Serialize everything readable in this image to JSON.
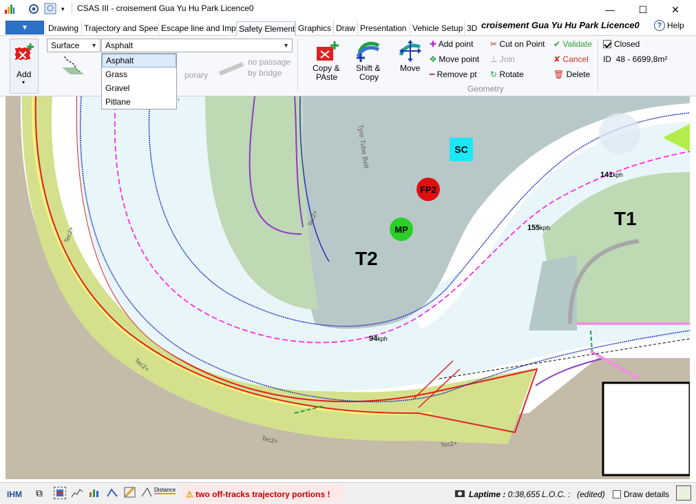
{
  "titlebar": {
    "title": "CSAS III - croisement Gua Yu Hu Park Licence0",
    "minimize": "—",
    "maximize": "☐",
    "close": "✕"
  },
  "tabs": [
    {
      "label": "Drawing"
    },
    {
      "label": "Trajectory and Spee"
    },
    {
      "label": "Escape line and Imp"
    },
    {
      "label": "Safety Element"
    },
    {
      "label": "Graphics"
    },
    {
      "label": "Draw"
    },
    {
      "label": "Presentation"
    },
    {
      "label": "Vehicle Setup"
    },
    {
      "label": "3D"
    }
  ],
  "document_title": "croisement Gua Yu Hu Park Licence0",
  "help_label": "Help",
  "ribbon": {
    "add_label": "Add",
    "surface_combo": "Surface",
    "material_combo": "Asphalt",
    "material_options": [
      "Asphalt",
      "Grass",
      "Gravel",
      "Pitlane"
    ],
    "no_passage": "no passage",
    "by_bridge": "by bridge",
    "faded_label": "porary",
    "copy_paste": [
      "Copy &",
      "PAste"
    ],
    "shift_copy": [
      "Shift &",
      "Copy"
    ],
    "move": "Move",
    "add_point": "Add point",
    "move_point": "Move point",
    "remove_pt": "Remove pt",
    "cut_on_point": "Cut on Point",
    "join": "Join",
    "rotate": "Rotate",
    "validate": "Validate",
    "cancel": "Cancel",
    "delete": "Delete",
    "geometry_group": "Geometry",
    "closed_label": "Closed",
    "closed_checked": true,
    "id_prefix": "ID",
    "id_value": "48 - 6699,8m²"
  },
  "map": {
    "labels": {
      "t1": "T1",
      "t2": "T2",
      "sc": "SC",
      "fp2": "FP2",
      "mp": "MP",
      "speed_141": "141",
      "speed_155": "155",
      "speed_94": "94",
      "speed_unit": "kph",
      "tyre_belt": "Tyre Tube Belt",
      "tec2_a": "Tec2+",
      "tec2_b": "Tec2+",
      "tec2_c": "Tec2+",
      "tec2_d": "Tec2+",
      "tec2_e": "Tec2+",
      "tec2_f": "Tec2+"
    },
    "colors": {
      "green_zone": "#d4e08c",
      "gray_zone": "#c4bba8",
      "track": "#e8f6fa",
      "infield": "#b8c8c8",
      "grass": "#bfd9b4",
      "red_line": "#e02020",
      "magenta": "#ff28e8",
      "purple": "#8a3cc6",
      "blue": "#2632b8"
    }
  },
  "status": {
    "ihm": "IHM",
    "distance_icon_text": "Distance",
    "warning": "two off-tracks trajectory portions !",
    "laptime_label": "Laptime :",
    "laptime_value": "0:38,655",
    "loc_label": "L.O.C. :",
    "edited": "(edited)",
    "draw_details": "Draw details",
    "draw_details_checked": false
  }
}
